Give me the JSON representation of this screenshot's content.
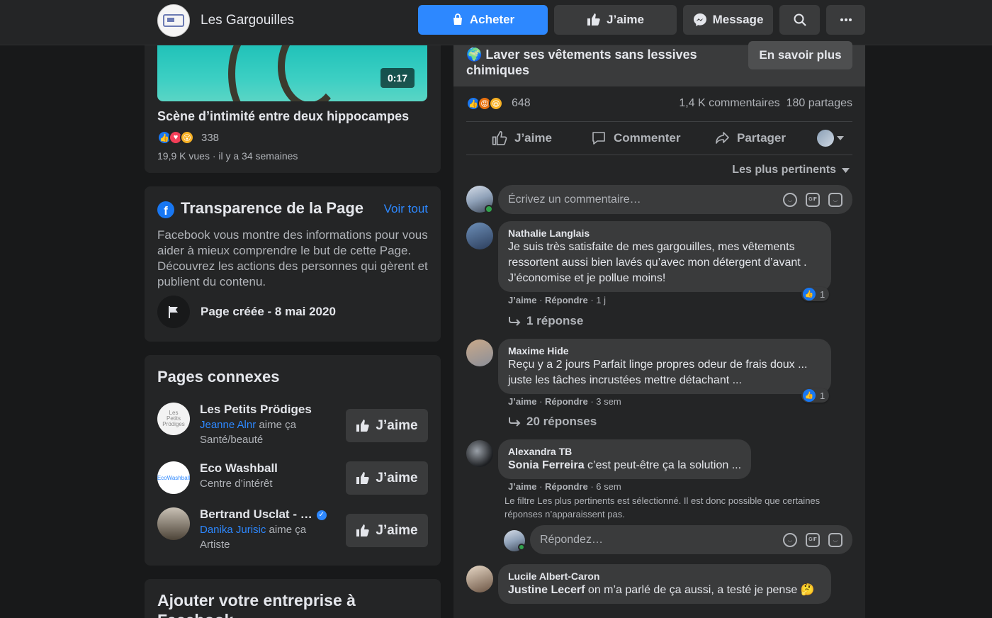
{
  "topbar": {
    "page_name": "Les Gargouilles",
    "buy_label": "Acheter",
    "like_label": "J’aime",
    "message_label": "Message"
  },
  "video": {
    "duration": "0:17",
    "title": "Scène d’intimité entre deux hippocampes",
    "reactions_count": "338",
    "meta": "19,9 K vues · il y a 34 semaines"
  },
  "transparency": {
    "title": "Transparence de la Page",
    "see_all": "Voir tout",
    "description": "Facebook vous montre des informations pour vous aider à mieux comprendre le but de cette Page. Découvrez les actions des personnes qui gèrent et publient du contenu.",
    "created": "Page créée - 8 mai 2020"
  },
  "related": {
    "title": "Pages connexes",
    "like_label": "J’aime",
    "items": [
      {
        "name": "Les Petits Prödiges",
        "friend": "Jeanne Alnr",
        "friend_suffix": " aime ça",
        "category": "Santé/beauté",
        "logo_text": "Les Petits Prödiges"
      },
      {
        "name": "Eco Washball",
        "category": "Centre d’intérêt",
        "logo_text": "EcoWashball"
      },
      {
        "name": "Bertrand Usclat - …",
        "friend": "Danika Jurisic",
        "friend_suffix": " aime ça",
        "category": "Artiste"
      }
    ]
  },
  "add_business": {
    "title": "Ajouter votre entreprise à Facebook"
  },
  "post": {
    "headline": "🌍 Laver ses vêtements sans lessives chimiques",
    "learn_more": "En savoir plus",
    "reactions_count": "648",
    "comments_count": "1,4 K commentaires",
    "shares_count": "180 partages",
    "actions": {
      "like": "J’aime",
      "comment": "Commenter",
      "share": "Partager"
    },
    "sort_label": "Les plus pertinents",
    "comment_placeholder": "Écrivez un commentaire…",
    "reply_placeholder": "Répondez…",
    "filter_note": "Le filtre Les plus pertinents est sélectionné. Il est donc possible que certaines réponses n’apparaissent pas."
  },
  "comments": [
    {
      "author": "Nathalie Langlais",
      "text": "Je suis très satisfaite de mes gargouilles, mes vêtements ressortent aussi bien lavés qu’avec mon détergent d’avant . J’économise et je pollue moins!",
      "like": "J’aime",
      "reply": "Répondre",
      "age": "1 j",
      "reactions": "1",
      "replies": "1 réponse"
    },
    {
      "author": "Maxime Hide",
      "text": "Reçu y a 2 jours Parfait linge propres odeur de frais doux ... juste les tâches incrustées mettre détachant ...",
      "like": "J’aime",
      "reply": "Répondre",
      "age": "3 sem",
      "reactions": "1",
      "replies": "20 réponses"
    },
    {
      "author": "Alexandra TB",
      "mention": "Sonia Ferreira",
      "text": " c’est peut-être ça la solution ...",
      "like": "J’aime",
      "reply": "Répondre",
      "age": "6 sem"
    },
    {
      "author": "Lucile Albert-Caron",
      "mention": "Justine Lecerf",
      "text": " on m’a parlé de ça aussi, a testé je pense 🤔"
    }
  ],
  "icons": {
    "buy": "shopping-bag-icon",
    "like": "thumbs-up-icon",
    "message": "messenger-icon",
    "search": "search-icon",
    "more": "more-icon",
    "flag": "flag-icon",
    "comment": "comment-icon",
    "share": "share-icon",
    "reply_arrow": "reply-arrow-icon",
    "emoji": "emoji-icon",
    "gif": "gif-icon",
    "sticker": "sticker-icon",
    "verified": "verified-badge-icon"
  },
  "colors": {
    "accent": "#2d88ff",
    "background": "#18191a",
    "surface": "#242526",
    "button": "#3a3b3c"
  }
}
